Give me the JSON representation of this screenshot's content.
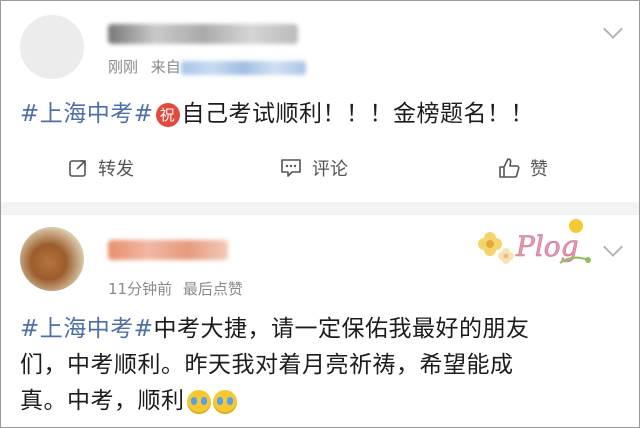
{
  "posts": [
    {
      "time": "刚刚",
      "source_prefix": "来自",
      "hashtag": "#上海中考#",
      "blessing_char": "祝",
      "body": "自己考试顺利！！！金榜题名！！",
      "actions": {
        "repost": "转发",
        "comment": "评论",
        "like": "赞"
      }
    },
    {
      "time": "11分钟前",
      "extra": "最后点赞",
      "hashtag": "#上海中考#",
      "body_line1": "中考大捷，请一定保佑我最好的朋友",
      "body_line2": "们，中考顺利。昨天我对着月亮祈祷，希望能成",
      "body_line3": "真。中考，顺利",
      "sticker_text": "Plog"
    }
  ],
  "icons": [
    "chevron-down-icon",
    "repost-icon",
    "comment-icon",
    "like-icon",
    "crying-emoji-icon",
    "blessing-icon"
  ],
  "colors": {
    "hashtag": "#4e6fa7",
    "text": "#1c1c1c",
    "meta": "#8a8a8a",
    "separator": "#f2f2f2",
    "blessing": "#e24a3b"
  }
}
